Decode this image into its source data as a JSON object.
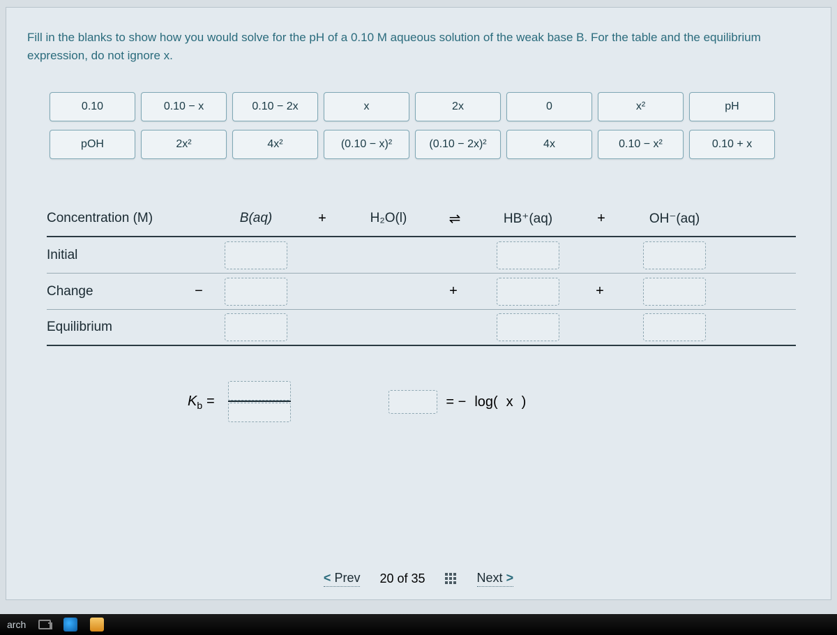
{
  "question": "Fill in the blanks to show how you would solve for the pH of a 0.10 M aqueous solution of the weak base B. For the table and the equilibrium expression, do not ignore x.",
  "tiles": {
    "row1": [
      "0.10",
      "0.10 − x",
      "0.10 − 2x",
      "x",
      "2x",
      "0",
      "x²",
      "pH"
    ],
    "row2": [
      "pOH",
      "2x²",
      "4x²",
      "(0.10 − x)²",
      "(0.10 − 2x)²",
      "4x",
      "0.10 − x²",
      "0.10 + x"
    ]
  },
  "ice": {
    "header_label": "Concentration (M)",
    "species": {
      "b": "B(aq)",
      "water": "H₂O(l)",
      "hb": "HB⁺(aq)",
      "oh": "OH⁻(aq)"
    },
    "ops": {
      "plus1": "+",
      "arrow": "⇌",
      "plus2": "+"
    },
    "rows": {
      "initial": "Initial",
      "change": "Change",
      "equilibrium": "Equilibrium"
    },
    "change_signs": {
      "b": "−",
      "hb": "+",
      "oh": "+"
    }
  },
  "kb": {
    "label": "K_b =",
    "rhs_prefix": "= −",
    "log_open": "log(",
    "log_var": "x",
    "log_close": ")"
  },
  "nav": {
    "prev": "Prev",
    "counter": "20 of 35",
    "next": "Next"
  },
  "taskbar": {
    "search": "arch"
  }
}
